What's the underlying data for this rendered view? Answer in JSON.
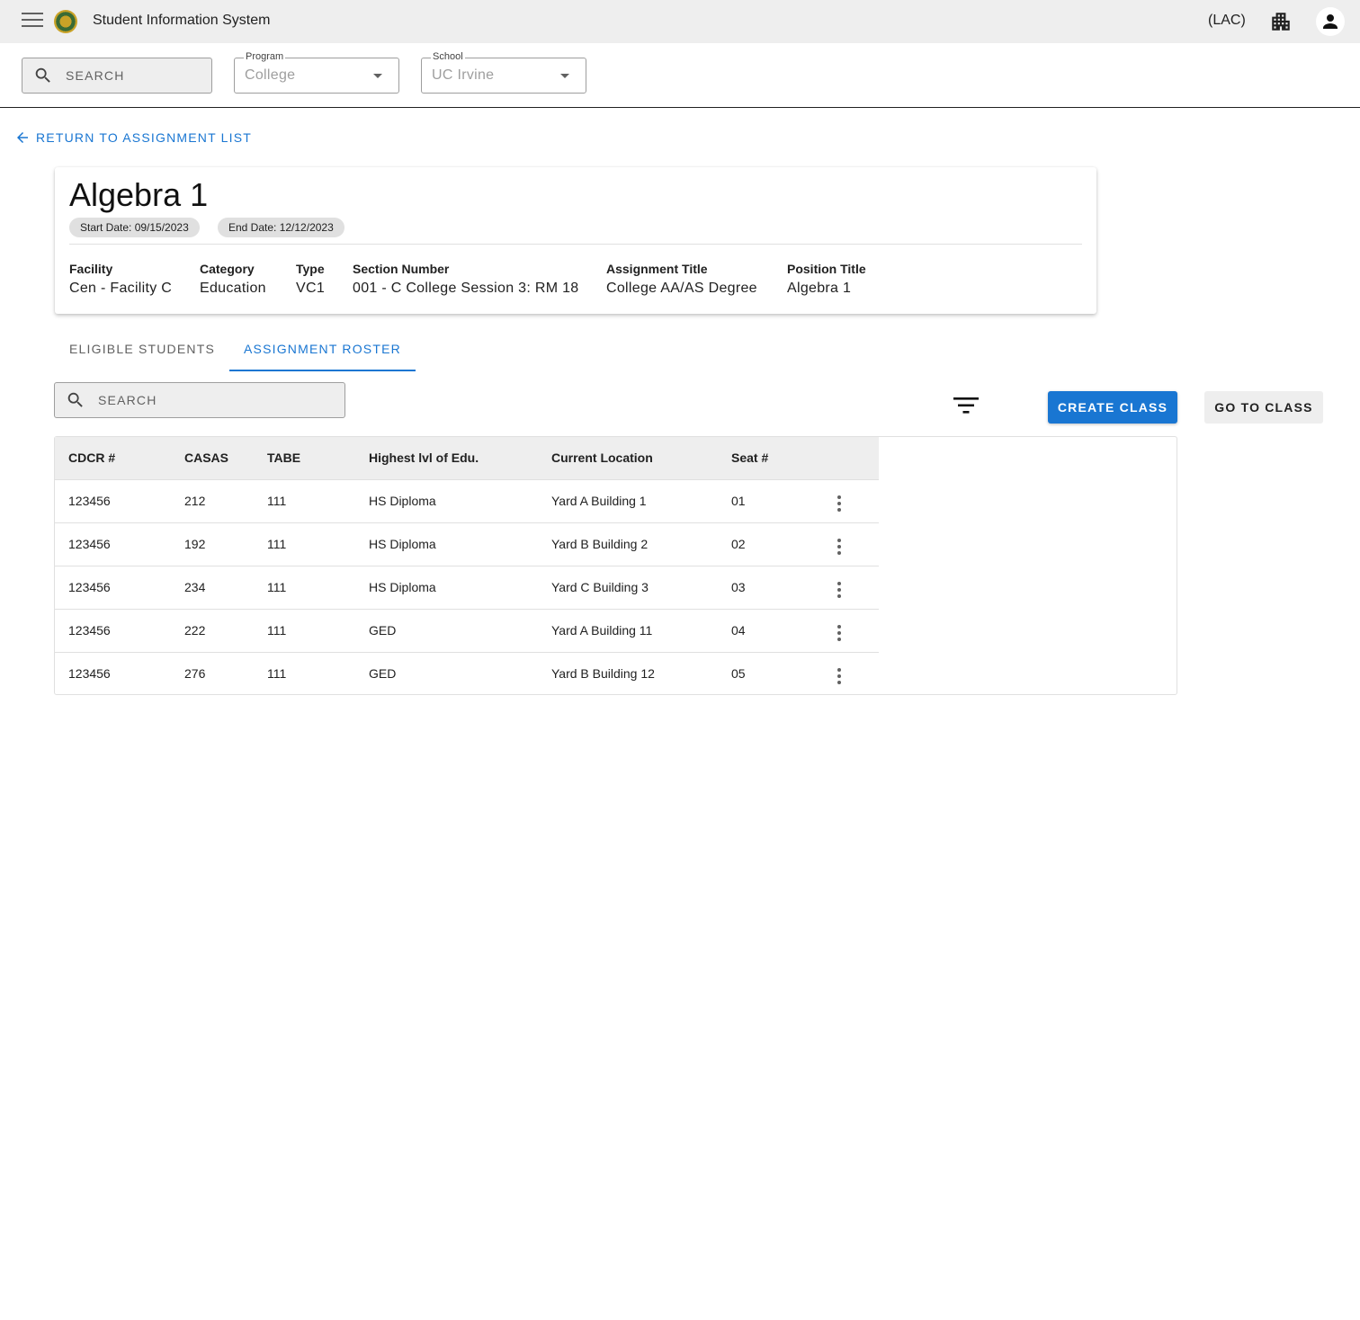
{
  "app": {
    "title": "Student Information System",
    "site_code": "(LAC)"
  },
  "filters": {
    "search_placeholder": "SEARCH",
    "program": {
      "label": "Program",
      "value": "College"
    },
    "school": {
      "label": "School",
      "value": "UC Irvine"
    }
  },
  "back_link": "RETURN TO ASSIGNMENT LIST",
  "assignment": {
    "title": "Algebra 1",
    "start_date": "Start Date: 09/15/2023",
    "end_date": "End Date: 12/12/2023",
    "fields": [
      {
        "label": "Facility",
        "value": "Cen - Facility C"
      },
      {
        "label": "Category",
        "value": "Education"
      },
      {
        "label": "Type",
        "value": "VC1"
      },
      {
        "label": "Section Number",
        "value": "001 - C College Session 3: RM 18"
      },
      {
        "label": "Assignment Title",
        "value": "College AA/AS Degree"
      },
      {
        "label": "Position Title",
        "value": "Algebra 1"
      }
    ]
  },
  "tabs": [
    {
      "label": "ELIGIBLE STUDENTS",
      "active": false
    },
    {
      "label": "ASSIGNMENT ROSTER",
      "active": true
    }
  ],
  "roster": {
    "search_placeholder": "SEARCH",
    "create_class_label": "CREATE CLASS",
    "go_to_class_label": "GO TO CLASS",
    "columns": [
      "CDCR #",
      "CASAS",
      "TABE",
      "Highest lvl of Edu.",
      "Current Location",
      "Seat #"
    ],
    "rows": [
      [
        "123456",
        "212",
        "111",
        "HS Diploma",
        "Yard A Building 1",
        "01"
      ],
      [
        "123456",
        "192",
        "111",
        "HS Diploma",
        "Yard B Building 2",
        "02"
      ],
      [
        "123456",
        "234",
        "111",
        "HS Diploma",
        "Yard C Building 3",
        "03"
      ],
      [
        "123456",
        "222",
        "111",
        "GED",
        "Yard A Building 11",
        "04"
      ],
      [
        "123456",
        "276",
        "111",
        "GED",
        "Yard B Building 12",
        "05"
      ]
    ]
  },
  "colors": {
    "primary": "#1976d2",
    "appbar": "#eeeeee",
    "table_header": "#eeeeee"
  }
}
